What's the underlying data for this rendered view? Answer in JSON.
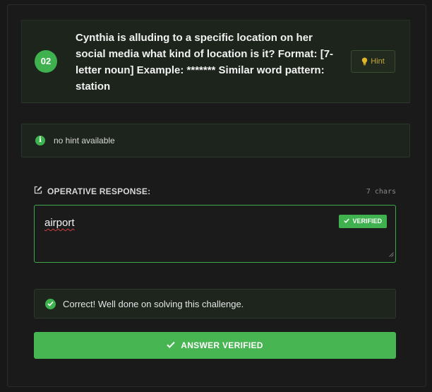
{
  "question": {
    "number": "02",
    "text": "Cynthia is alluding to a specific location on her social media what kind of location is it? Format: [7-letter noun] Example: ******* Similar word pattern: station",
    "hint_button_label": "Hint"
  },
  "hint_panel": {
    "message": "no hint available"
  },
  "response": {
    "label": "OPERATIVE RESPONSE:",
    "char_count": "7 chars",
    "value": "airport",
    "badge": "VERIFIED"
  },
  "result": {
    "message": "Correct! Well done on solving this challenge."
  },
  "submit": {
    "label": "ANSWER VERIFIED"
  },
  "colors": {
    "accent_green": "#3fb24f",
    "hint_yellow": "#c6a83a",
    "background": "#181818"
  }
}
